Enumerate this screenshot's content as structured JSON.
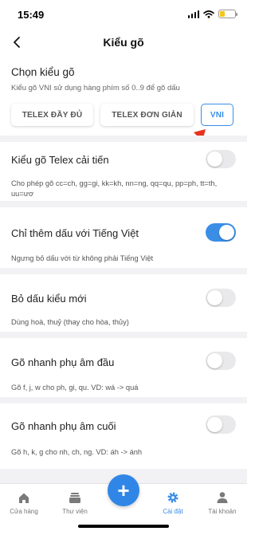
{
  "status": {
    "time": "15:49"
  },
  "nav": {
    "title": "Kiểu gõ"
  },
  "input_method": {
    "title": "Chọn kiểu gõ",
    "desc": "Kiểu gõ VNI sử dụng hàng phím số 0..9 để gõ dấu",
    "options": [
      "TELEX ĐẦY ĐỦ",
      "TELEX ĐƠN GIẢN",
      "VNI"
    ],
    "selected": "VNI"
  },
  "settings": [
    {
      "title": "Kiểu gõ Telex cải tiến",
      "desc": "Cho phép gõ cc=ch, gg=gi, kk=kh, nn=ng, qq=qu, pp=ph, tt=th, uu=ươ",
      "on": false
    },
    {
      "title": "Chỉ thêm dấu với Tiếng Việt",
      "desc": "Ngưng bỏ dấu với từ không phải Tiếng Việt",
      "on": true
    },
    {
      "title": "Bỏ dấu kiểu mới",
      "desc": "Dùng hoà, thuỷ (thay cho hòa, thủy)",
      "on": false
    },
    {
      "title": "Gõ nhanh phụ âm đầu",
      "desc": "Gõ f, j, w cho ph, gi, qu. VD: wá -> quá",
      "on": false
    },
    {
      "title": "Gõ nhanh phụ âm cuối",
      "desc": "Gõ h, k, g cho nh, ch, ng. VD: áh -> ánh",
      "on": false
    }
  ],
  "tabbar": {
    "items": [
      "Cửa hàng",
      "Thư viện",
      "Cài đặt",
      "Tài khoản"
    ],
    "active": "Cài đặt"
  },
  "colors": {
    "accent": "#3a8ee6",
    "annotation_arrow": "#e8321e"
  }
}
